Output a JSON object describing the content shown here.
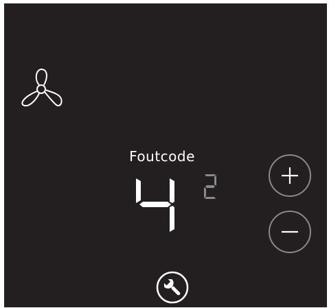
{
  "screen": {
    "background_color": "#231f20",
    "text_color": "#ffffff",
    "dim_color": "#8a8a8a"
  },
  "fan": {
    "icon": "fan-icon"
  },
  "error": {
    "label": "Foutcode",
    "main_code": "4",
    "sub_code": "2"
  },
  "controls": {
    "plus_icon": "plus-icon",
    "minus_icon": "minus-icon",
    "service_icon": "wrench-icon"
  }
}
